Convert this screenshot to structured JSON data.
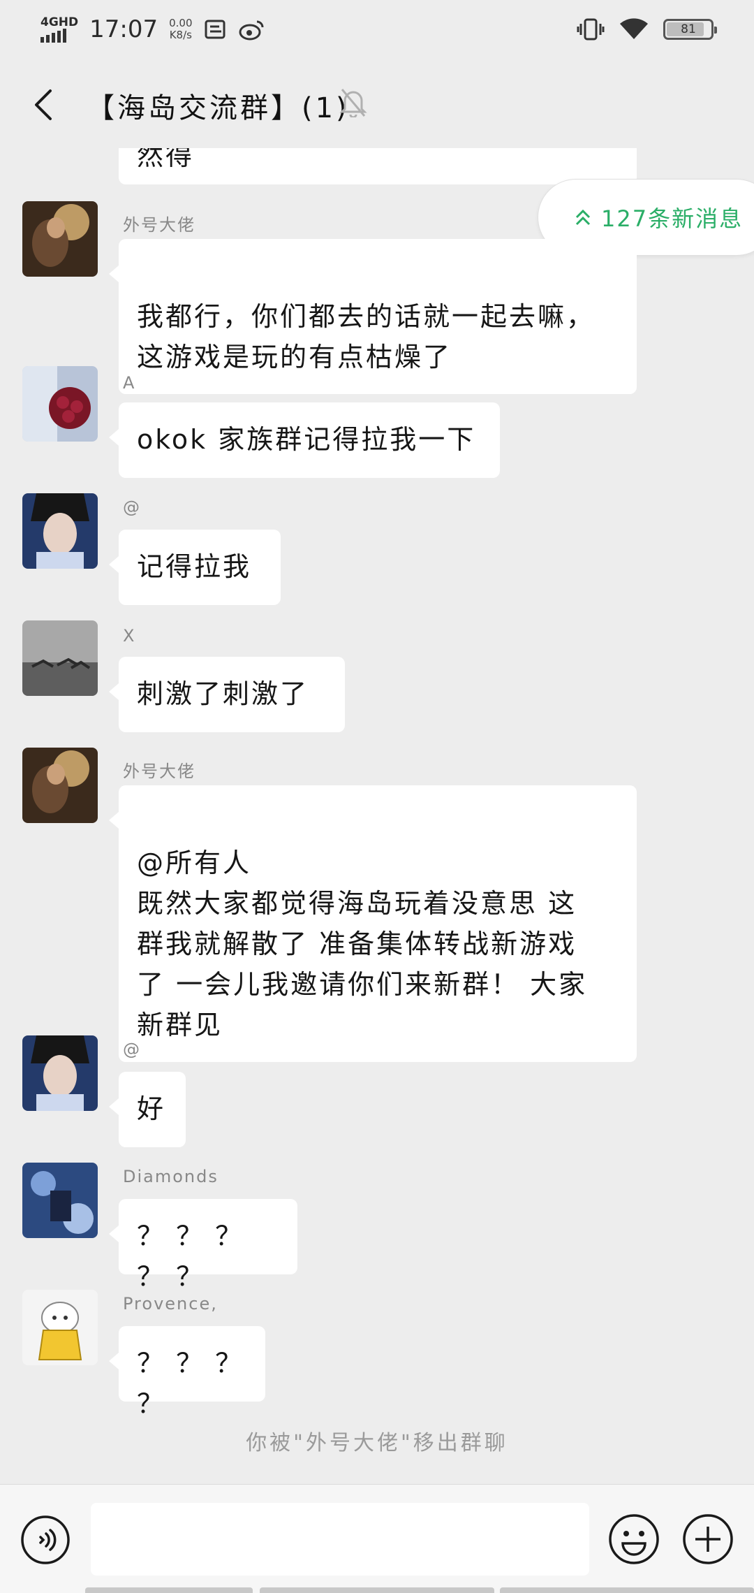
{
  "status_bar": {
    "network": "4GHD",
    "time": "17:07",
    "speed_value": "0.00",
    "speed_unit": "K8/s",
    "battery": "81"
  },
  "header": {
    "title": "【海岛交流群】(1)"
  },
  "new_messages_label": "127条新消息",
  "messages": [
    {
      "sender": "",
      "text": "然得"
    },
    {
      "sender": "外号大佬",
      "text": "我都行，你们都去的话就一起去嘛，\n这游戏是玩的有点枯燥了"
    },
    {
      "sender": "A",
      "text": "okok 家族群记得拉我一下"
    },
    {
      "sender": "@",
      "text": "记得拉我"
    },
    {
      "sender": "X",
      "text": "刺激了刺激了"
    },
    {
      "sender": "外号大佬",
      "text": "@所有人\n既然大家都觉得海岛玩着没意思 这\n群我就解散了 准备集体转战新游戏\n了 一会儿我邀请你们来新群！ 大家\n新群见"
    },
    {
      "sender": "@",
      "text": "好"
    },
    {
      "sender": "Diamonds",
      "text": "？ ？ ？ ？ ？"
    },
    {
      "sender": "Provence,",
      "text": "？ ？ ？ ？"
    }
  ],
  "system_tip": "你被\"外号大佬\"移出群聊",
  "input": {
    "placeholder": ""
  },
  "colors": {
    "background": "#ededed",
    "bubble": "#ffffff",
    "accent_green": "#2aae67"
  }
}
